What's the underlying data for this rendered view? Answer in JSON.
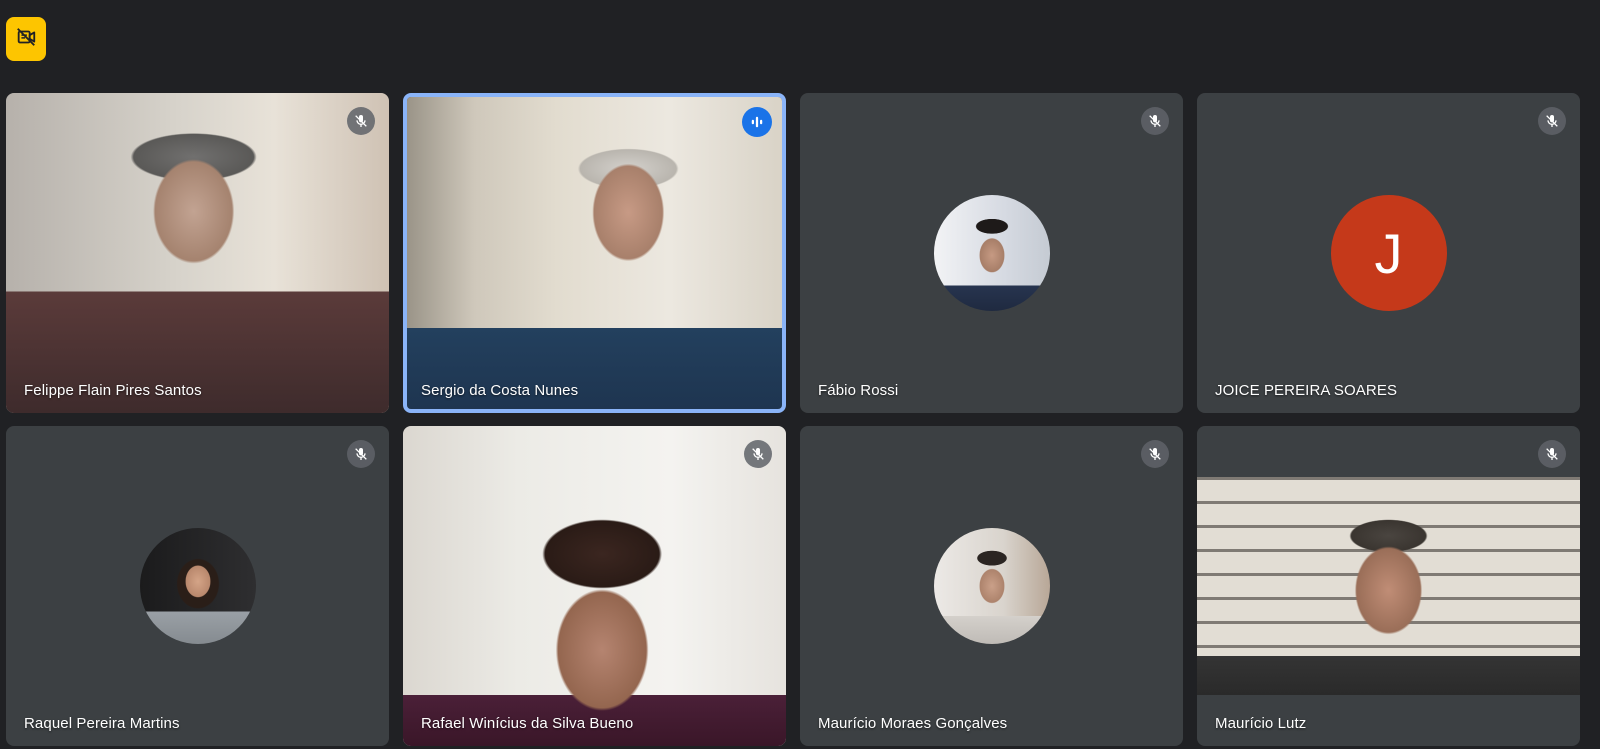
{
  "toolbar": {
    "icon": "camera-off-icon",
    "accent_color": "#fdc500"
  },
  "participants": [
    {
      "name": "Felippe Flain Pires Santos",
      "muted": true,
      "speaking": false,
      "display": "video"
    },
    {
      "name": "Sergio da Costa Nunes",
      "muted": false,
      "speaking": true,
      "display": "video"
    },
    {
      "name": "Fábio Rossi",
      "muted": true,
      "speaking": false,
      "display": "avatar-photo"
    },
    {
      "name": "JOICE PEREIRA SOARES",
      "muted": true,
      "speaking": false,
      "display": "avatar-letter",
      "initial": "J",
      "avatar_color": "#c5391a"
    },
    {
      "name": "Raquel Pereira Martins",
      "muted": true,
      "speaking": false,
      "display": "avatar-photo"
    },
    {
      "name": "Rafael Winícius da Silva Bueno",
      "muted": true,
      "speaking": false,
      "display": "video"
    },
    {
      "name": "Maurício Moraes Gonçalves",
      "muted": true,
      "speaking": false,
      "display": "avatar-photo"
    },
    {
      "name": "Maurício Lutz",
      "muted": true,
      "speaking": false,
      "display": "video"
    }
  ],
  "colors": {
    "background": "#202124",
    "tile": "#3c4043",
    "active_border": "#8ab4f8",
    "speaking_indicator": "#1a73e8"
  }
}
